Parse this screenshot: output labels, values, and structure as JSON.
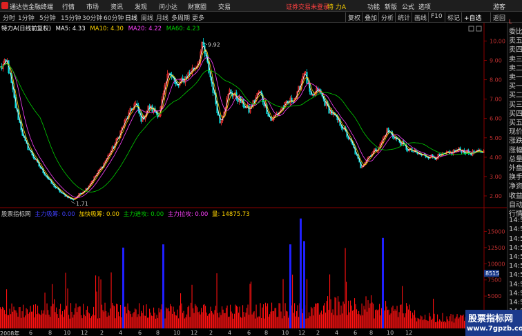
{
  "titlebar": {
    "app_name": "通达信金融终端",
    "menu": [
      "行情",
      "市场",
      "资讯",
      "发现",
      "问小达",
      "财富圈",
      "交易"
    ],
    "notice": "证券交易未登录",
    "stock_name": "特 力A",
    "right_menu": [
      "功能",
      "新版",
      "公式",
      "选项"
    ],
    "guest": "游客"
  },
  "periodbar": {
    "periods": [
      "分时",
      "1分钟",
      "5分钟",
      "15分钟",
      "30分钟",
      "60分钟",
      "日线",
      "周线",
      "月线",
      "多周期",
      "更多"
    ],
    "active": "日线",
    "tools": [
      "复权",
      "叠加",
      "分析",
      "统计",
      "画线",
      "F10",
      "标记",
      "返回"
    ]
  },
  "kline_info": {
    "title": "特力A(日线前复权)",
    "ma5_label": "MA5: 4.33",
    "ma10_label": "MA10: 4.30",
    "ma20_label": "MA20: 4.22",
    "ma60_label": "MA60: 4.23",
    "high_marker": "9.92",
    "low_marker": "1.71",
    "colors": {
      "ma5": "#ffffff",
      "ma10": "#ffd400",
      "ma20": "#ff40ff",
      "ma60": "#00d000"
    }
  },
  "price_axis": [
    "10.00",
    "9.00",
    "8.00",
    "7.00",
    "6.00",
    "5.00",
    "4.00",
    "3.00",
    "2.00"
  ],
  "indicator": {
    "title": "股票指标网",
    "main_absorb": "主力吸筹: 0.00",
    "accelerate": "加快吸筹: 0.00",
    "attack": "主力进攻: 0.00",
    "rally": "主力拉攻: 0.00",
    "volume": "量: 14875.73",
    "axis": [
      "15000",
      "12500",
      "10000",
      "7500",
      "5000"
    ],
    "current_tag": "8515"
  },
  "x_axis": [
    "2008年",
    "6",
    "8",
    "10",
    "12",
    "2",
    "4",
    "6",
    "8",
    "10",
    "12",
    "2",
    "4",
    "6",
    "8",
    "10",
    "12",
    "2",
    "4",
    "6",
    "8",
    "10",
    "12"
  ],
  "right_panel": {
    "items": [
      "委比",
      "卖五",
      "卖四",
      "卖三",
      "卖二",
      "卖一",
      "买一",
      "买二",
      "买三",
      "买四",
      "买五",
      "现价",
      "涨跌",
      "涨幅",
      "总量",
      "外盘",
      "换手",
      "净资",
      "收益",
      "自动",
      "行情",
      "14:5",
      "14:5",
      "14:5",
      "14:5",
      "14:5",
      "14:5",
      "14:5",
      "14:5",
      "14:5",
      "14:5",
      "14:5",
      "14:5"
    ],
    "red_tag": "L"
  },
  "watermark": {
    "line1": "股票指标网",
    "line2": "www.7gpzb.com"
  },
  "chart_data": {
    "type": "candlestick",
    "anchors": [
      [
        0,
        8.6
      ],
      [
        10,
        8.9
      ],
      [
        22,
        6.6
      ],
      [
        35,
        4.8
      ],
      [
        55,
        3.6
      ],
      [
        75,
        2.6
      ],
      [
        90,
        2.1
      ],
      [
        105,
        1.8
      ],
      [
        125,
        2.4
      ],
      [
        145,
        3.4
      ],
      [
        165,
        4.6
      ],
      [
        180,
        5.8
      ],
      [
        195,
        6.8
      ],
      [
        205,
        5.9
      ],
      [
        215,
        6.6
      ],
      [
        230,
        6.2
      ],
      [
        245,
        8.6
      ],
      [
        255,
        7.6
      ],
      [
        270,
        8.2
      ],
      [
        285,
        8.8
      ],
      [
        293,
        9.8
      ],
      [
        305,
        8.0
      ],
      [
        318,
        5.8
      ],
      [
        332,
        7.4
      ],
      [
        345,
        7.0
      ],
      [
        360,
        6.4
      ],
      [
        375,
        7.4
      ],
      [
        392,
        5.9
      ],
      [
        410,
        6.6
      ],
      [
        430,
        7.2
      ],
      [
        440,
        8.5
      ],
      [
        450,
        7.0
      ],
      [
        460,
        7.5
      ],
      [
        475,
        6.5
      ],
      [
        495,
        5.6
      ],
      [
        510,
        4.6
      ],
      [
        522,
        3.5
      ],
      [
        535,
        4.1
      ],
      [
        550,
        4.6
      ],
      [
        560,
        5.4
      ],
      [
        572,
        5.0
      ],
      [
        590,
        4.4
      ],
      [
        610,
        4.1
      ],
      [
        630,
        4.0
      ],
      [
        650,
        4.2
      ],
      [
        665,
        4.4
      ],
      [
        680,
        4.2
      ],
      [
        700,
        4.3
      ]
    ],
    "ylim": [
      1.5,
      10.3
    ],
    "volume_ylim": [
      0,
      17500
    ],
    "volume_bursts": [
      [
        178,
        12500
      ],
      [
        236,
        13000
      ],
      [
        420,
        13000
      ],
      [
        435,
        17000
      ],
      [
        440,
        13500
      ],
      [
        554,
        14000
      ]
    ]
  }
}
